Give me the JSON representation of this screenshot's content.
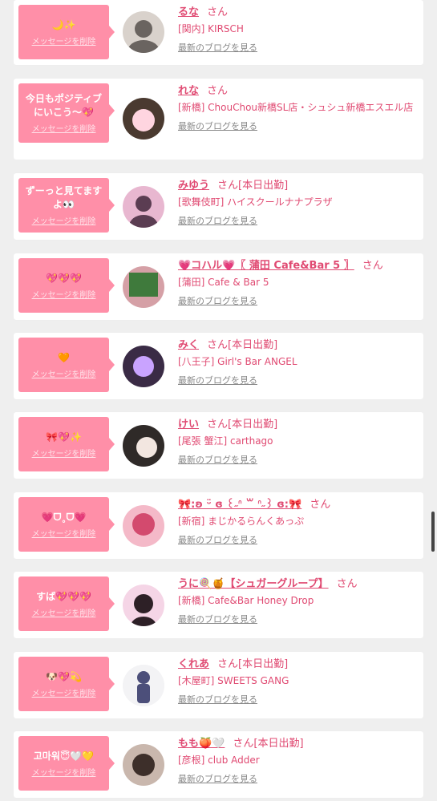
{
  "delete_label": "メッセージを削除",
  "blog_label": "最新のブログを見る",
  "honorific": "さん",
  "cards": [
    {
      "message": "🌙✨",
      "name": "るな",
      "status": "",
      "shop": "[関内] KIRSCH",
      "avatar": {
        "bg": "#d9d2cc",
        "fg": "#6a6460"
      }
    },
    {
      "message": "今日もポジティブにいこう〜💖",
      "name": "れな",
      "status": "",
      "shop": "[新橋] ChouChou新橋SL店・シュシュ新橋エスエル店",
      "avatar": {
        "bg": "#4a3a30",
        "fg": "#ffd5e0"
      }
    },
    {
      "message": "ずーっと見てますよ👀",
      "name": "みゆう",
      "status": "[本日出勤]",
      "shop": "[歌舞伎町] ハイスクールナナプラザ",
      "avatar": {
        "bg": "#e8b7d0",
        "fg": "#5b3d52"
      }
    },
    {
      "message": "💖💖💖",
      "name": "💗コハル💗〖 蒲田 Cafe&Bar 5 〗",
      "status": "",
      "shop": "[蒲田] Cafe & Bar 5",
      "avatar": {
        "bg": "#d5a0a6",
        "fg": "#3f7a3c"
      }
    },
    {
      "message": "🧡",
      "name": "みく",
      "status": "[本日出勤]",
      "shop": "[八王子] Girl's Bar ANGEL",
      "avatar": {
        "bg": "#3a2b45",
        "fg": "#c9a3ff"
      }
    },
    {
      "message": "🎀💖✨",
      "name": "けい",
      "status": "[本日出勤]",
      "shop": "[尾張 蟹江] carthago",
      "avatar": {
        "bg": "#2f2a28",
        "fg": "#f2e6e0"
      }
    },
    {
      "message": "💗ᗜ˳ᗜ💗",
      "name": "🎀:ʚ ᵕ̈ ɞ ꒰˶ᐢ ꒳ ᐢ˶꒱ ɞ:🎀",
      "status": "",
      "shop": "[新宿] まじかるらんくあっぷ",
      "avatar": {
        "bg": "#f4b9c8",
        "fg": "#d34a6e"
      }
    },
    {
      "message": "すば💖💖💖",
      "name": "うに🍭🍯【シュガーグループ】",
      "status": "",
      "shop": "[新橋] Cafe&Bar Honey Drop",
      "avatar": {
        "bg": "#f5d5e6",
        "fg": "#2d2026"
      }
    },
    {
      "message": "🐶💖💫",
      "name": "くれあ",
      "status": "[本日出勤]",
      "shop": "[木屋町] SWEETS GANG",
      "avatar": {
        "bg": "#f3f3f5",
        "fg": "#4c4f7a"
      }
    },
    {
      "message": "고마워😇🤍💛",
      "name": "もも🍑🤍",
      "status": "[本日出勤]",
      "shop": "[彦根] club Adder",
      "avatar": {
        "bg": "#c9b7ad",
        "fg": "#3d2f2a"
      }
    }
  ]
}
